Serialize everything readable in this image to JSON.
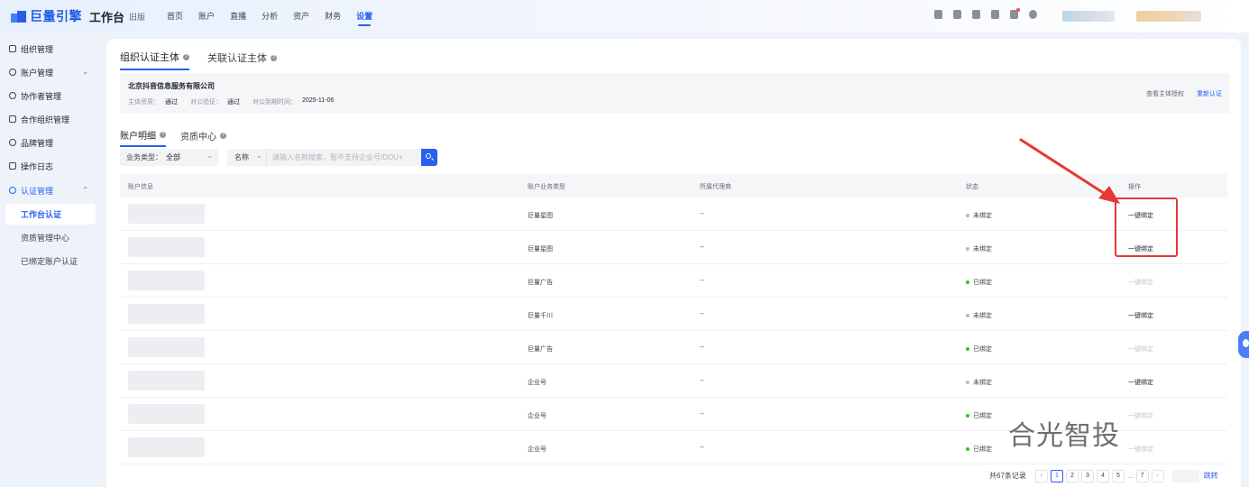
{
  "header": {
    "logo_text": "巨量引擎",
    "workbench": "工作台",
    "old_version": "旧版",
    "nav": [
      {
        "label": "首页",
        "active": false
      },
      {
        "label": "账户",
        "active": false
      },
      {
        "label": "直播",
        "active": false
      },
      {
        "label": "分析",
        "active": false
      },
      {
        "label": "资产",
        "active": false
      },
      {
        "label": "财务",
        "active": false
      },
      {
        "label": "设置",
        "active": true
      }
    ]
  },
  "sidebar": {
    "items": [
      {
        "label": "组织管理"
      },
      {
        "label": "账户管理"
      },
      {
        "label": "协作者管理"
      },
      {
        "label": "合作组织管理"
      },
      {
        "label": "品牌管理"
      },
      {
        "label": "操作日志"
      },
      {
        "label": "认证管理"
      }
    ],
    "sub_items": [
      {
        "label": "工作台认证",
        "active": true
      },
      {
        "label": "资质管理中心",
        "active": false
      },
      {
        "label": "已绑定账户认证",
        "active": false
      }
    ]
  },
  "main": {
    "tabs": [
      {
        "label": "组织认证主体",
        "active": true
      },
      {
        "label": "关联认证主体",
        "active": false
      }
    ],
    "entity": {
      "name": "北京抖音信息服务有限公司",
      "qual_label": "主体资质：",
      "qual_value": "通过",
      "corp_label": "对公验证：",
      "corp_value": "通过",
      "expire_label": "对公到期时间：",
      "expire_value": "2025-11-06",
      "link_view": "查看主体授权",
      "link_reauth": "重新认证"
    },
    "subtabs": [
      {
        "label": "账户明细",
        "active": true
      },
      {
        "label": "资质中心",
        "active": false
      }
    ],
    "filter": {
      "type_label": "业务类型：",
      "type_value": "全部",
      "name_select": "名称",
      "search_placeholder": "请输入名称搜索，暂不支持企业号/DOU+"
    },
    "table": {
      "columns": [
        "账户信息",
        "账户业务类型",
        "所属代理商",
        "状态",
        "操作"
      ],
      "rows": [
        {
          "type": "巨量星图",
          "agency": "--",
          "status": "未绑定",
          "status_kind": "unbound",
          "op": "一键绑定",
          "op_enabled": true
        },
        {
          "type": "巨量星图",
          "agency": "--",
          "status": "未绑定",
          "status_kind": "unbound",
          "op": "一键绑定",
          "op_enabled": true
        },
        {
          "type": "巨量广告",
          "agency": "--",
          "status": "已绑定",
          "status_kind": "bound",
          "op": "一键绑定",
          "op_enabled": false
        },
        {
          "type": "巨量千川",
          "agency": "--",
          "status": "未绑定",
          "status_kind": "unbound",
          "op": "一键绑定",
          "op_enabled": true
        },
        {
          "type": "巨量广告",
          "agency": "--",
          "status": "已绑定",
          "status_kind": "bound",
          "op": "一键绑定",
          "op_enabled": false
        },
        {
          "type": "企业号",
          "agency": "--",
          "status": "未绑定",
          "status_kind": "unbound",
          "op": "一键绑定",
          "op_enabled": true
        },
        {
          "type": "企业号",
          "agency": "--",
          "status": "已绑定",
          "status_kind": "bound",
          "op": "一键绑定",
          "op_enabled": false
        },
        {
          "type": "企业号",
          "agency": "--",
          "status": "已绑定",
          "status_kind": "bound",
          "op": "一键绑定",
          "op_enabled": false
        }
      ]
    },
    "pagination": {
      "total": "共67条记录",
      "pages": [
        "1",
        "2",
        "3",
        "4",
        "5"
      ],
      "current": "1",
      "ellipsis": "...",
      "last": "7",
      "prev": "‹",
      "next": "›",
      "jump": "跳转"
    }
  },
  "watermark_text": "合光智投",
  "colors": {
    "accent": "#2b5ff0",
    "bound": "#34c724",
    "unbound": "#b6bac0",
    "annotation": "#e53935"
  }
}
